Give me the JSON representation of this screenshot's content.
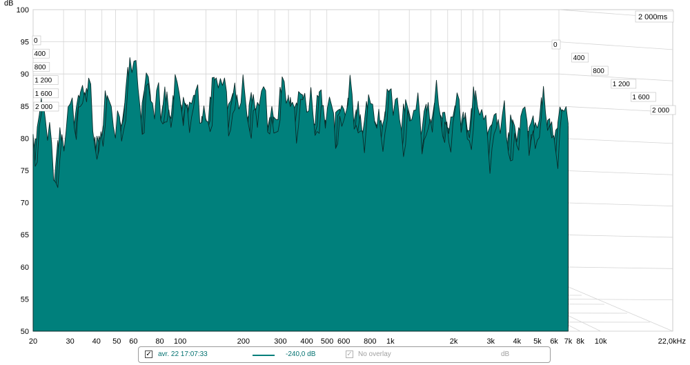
{
  "chart_data": {
    "type": "area",
    "view": "waterfall-3d",
    "ylabel": "dB",
    "y_ticks": [
      50,
      55,
      60,
      65,
      70,
      75,
      80,
      85,
      90,
      95,
      100
    ],
    "ylim": [
      50,
      100
    ],
    "x_ticks": [
      {
        "value": 20,
        "label": "20"
      },
      {
        "value": 30,
        "label": "30"
      },
      {
        "value": 40,
        "label": "40"
      },
      {
        "value": 50,
        "label": "50"
      },
      {
        "value": 60,
        "label": "60"
      },
      {
        "value": 80,
        "label": "80"
      },
      {
        "value": 100,
        "label": "100"
      },
      {
        "value": 200,
        "label": "200"
      },
      {
        "value": 300,
        "label": "300"
      },
      {
        "value": 400,
        "label": "400"
      },
      {
        "value": 500,
        "label": "500"
      },
      {
        "value": 600,
        "label": "600"
      },
      {
        "value": 800,
        "label": "800"
      },
      {
        "value": 1000,
        "label": "1k"
      },
      {
        "value": 2000,
        "label": "2k"
      },
      {
        "value": 3000,
        "label": "3k"
      },
      {
        "value": 4000,
        "label": "4k"
      },
      {
        "value": 5000,
        "label": "5k"
      },
      {
        "value": 6000,
        "label": "6k"
      },
      {
        "value": 7000,
        "label": "7k"
      },
      {
        "value": 8000,
        "label": "8k"
      },
      {
        "value": 10000,
        "label": "10k"
      },
      {
        "value": 22000,
        "label": "22,0kHz"
      }
    ],
    "xlim": [
      20,
      22000
    ],
    "x_scale": "log",
    "time_ticks_ms": [
      0,
      400,
      800,
      1200,
      1600,
      2000
    ],
    "time_tick_labels": [
      "0",
      "400",
      "800",
      "1 200",
      "1 600",
      "2 000"
    ],
    "time_max_label": "2 000ms",
    "series_color": "#00807c",
    "grid": true,
    "front_slice_envelope": {
      "x_hz": [
        20,
        22,
        25,
        28,
        30,
        33,
        35,
        38,
        40,
        44,
        48,
        52,
        56,
        60,
        65,
        70,
        76,
        80,
        90,
        100,
        110,
        125,
        140,
        160,
        180,
        200,
        230,
        260,
        300,
        350,
        400,
        450,
        500,
        600,
        700,
        800,
        1000,
        1300,
        1600,
        2000,
        2500,
        3000,
        4000,
        5000,
        6000,
        7000
      ],
      "y_db": [
        80,
        83,
        76,
        79,
        82,
        86,
        88,
        82,
        78,
        85,
        80,
        84,
        86,
        91,
        84,
        89,
        81,
        86,
        84,
        85,
        86,
        82,
        86,
        87,
        85,
        84,
        85,
        83,
        84,
        86,
        83,
        85,
        82,
        84,
        83,
        82,
        84,
        82,
        83,
        82,
        83,
        81,
        80,
        82,
        81,
        82
      ]
    }
  },
  "legend": {
    "timestamp": "avr. 22 17:07:33",
    "level": "-240,0 dB",
    "overlay": "No overlay",
    "unit": "dB",
    "check_mark": "✓"
  }
}
